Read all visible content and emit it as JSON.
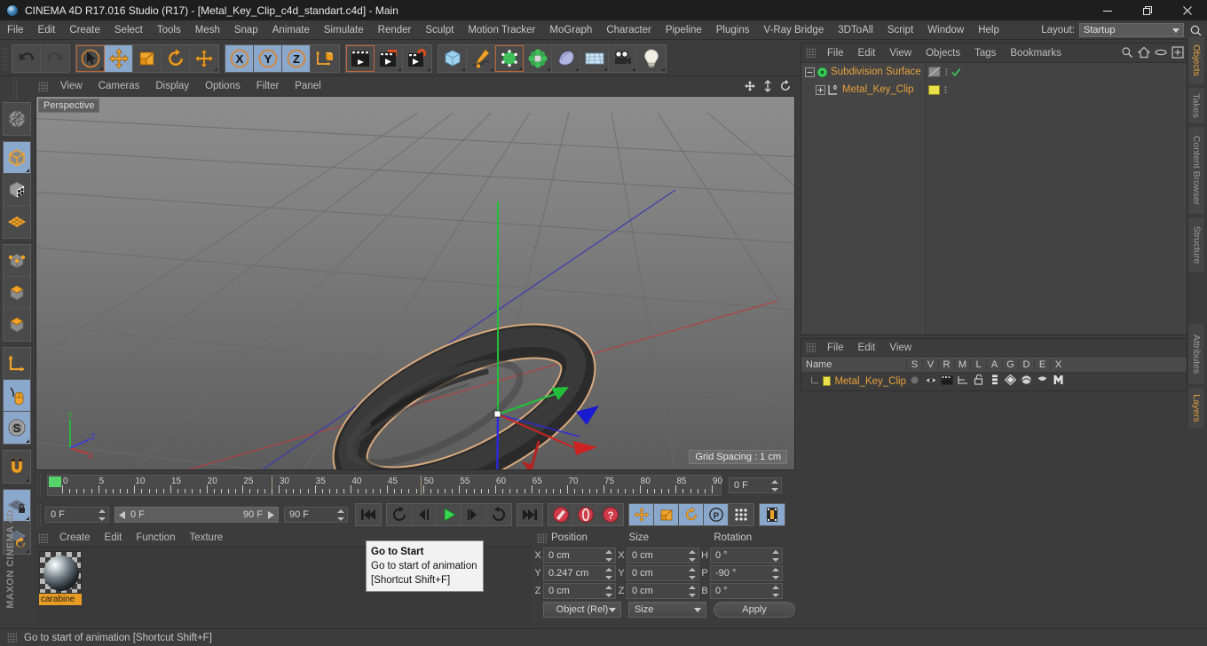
{
  "window": {
    "title": "CINEMA 4D R17.016 Studio (R17) - [Metal_Key_Clip_c4d_standart.c4d] - Main",
    "minimize": "—",
    "maximize": "❐",
    "close": "✕"
  },
  "menubar": {
    "items": [
      "File",
      "Edit",
      "Create",
      "Select",
      "Tools",
      "Mesh",
      "Snap",
      "Animate",
      "Simulate",
      "Render",
      "Sculpt",
      "Motion Tracker",
      "MoGraph",
      "Character",
      "Pipeline",
      "Plugins",
      "V-Ray Bridge",
      "3DToAll",
      "Script",
      "Window",
      "Help"
    ],
    "layout_label": "Layout:",
    "layout_value": "Startup",
    "search_icon": "search-icon"
  },
  "toolbar": {
    "groups": [
      {
        "name": "undo-redo",
        "buttons": [
          {
            "name": "undo-icon",
            "label": "Undo"
          },
          {
            "name": "redo-icon",
            "label": "Redo"
          }
        ]
      },
      {
        "name": "tools",
        "buttons": [
          {
            "name": "live-selection-icon",
            "label": "Live Selection"
          },
          {
            "name": "move-icon",
            "label": "Move"
          },
          {
            "name": "scale-icon",
            "label": "Scale"
          },
          {
            "name": "rotate-icon",
            "label": "Rotate"
          },
          {
            "name": "move-variant-icon",
            "label": "Move Tool Variant"
          }
        ]
      },
      {
        "name": "axis-locks",
        "buttons": [
          {
            "name": "axis-x-icon",
            "label": "X"
          },
          {
            "name": "axis-y-icon",
            "label": "Y"
          },
          {
            "name": "axis-z-icon",
            "label": "Z"
          },
          {
            "name": "world-object-coordinate-icon",
            "label": "World/Object"
          }
        ]
      },
      {
        "name": "render",
        "buttons": [
          {
            "name": "render-view-icon",
            "label": "Render View"
          },
          {
            "name": "render-region-icon",
            "label": "Render to Picture Viewer"
          },
          {
            "name": "render-settings-icon",
            "label": "Edit Render Settings"
          }
        ]
      },
      {
        "name": "objects",
        "buttons": [
          {
            "name": "cube-primitive-icon",
            "label": "Add Cube Object"
          },
          {
            "name": "spline-pen-icon",
            "label": "Add Spline"
          },
          {
            "name": "generator-icon",
            "label": "Add Generator / NURBS"
          },
          {
            "name": "array-icon",
            "label": "Add Modelling Object"
          },
          {
            "name": "deformer-icon",
            "label": "Add Bend Deformer"
          },
          {
            "name": "floor-environment-icon",
            "label": "Add Environment / Floor"
          },
          {
            "name": "camera-icon",
            "label": "Add Camera"
          },
          {
            "name": "light-icon",
            "label": "Add Light"
          }
        ]
      }
    ]
  },
  "leftbar": {
    "buttons": [
      {
        "name": "make-editable-icon",
        "label": "Make Editable"
      },
      {
        "name": "model-mode-icon",
        "label": "Model Mode",
        "active": true
      },
      {
        "name": "texture-mode-icon",
        "label": "Texture Mode"
      },
      {
        "name": "workplane-mode-icon",
        "label": "Workplane Mode"
      },
      {
        "name": "points-mode-icon",
        "label": "Points Mode"
      },
      {
        "name": "edges-mode-icon",
        "label": "Edges Mode"
      },
      {
        "name": "polygons-mode-icon",
        "label": "Polygons Mode"
      },
      {
        "name": "object-axis-icon",
        "label": "Enable Axis Modification"
      },
      {
        "name": "viewport-solo-icon",
        "label": "Viewport Solo",
        "active": true
      },
      {
        "name": "snap-enable-icon",
        "label": "Enable Snapping",
        "active": true
      },
      {
        "name": "magnet-icon",
        "label": "Magnet"
      },
      {
        "name": "workplane-lock-icon",
        "label": "Lock Workplane",
        "active": true
      },
      {
        "name": "workplane-rotate-icon",
        "label": "Planar Workplane Rotate"
      }
    ],
    "brand": "MAXON CINEMA 4D"
  },
  "viewport": {
    "menu": [
      "View",
      "Cameras",
      "Display",
      "Options",
      "Filter",
      "Panel"
    ],
    "view_label": "Perspective",
    "grid_spacing": "Grid Spacing : 1 cm",
    "axis_gizmo": {
      "x": "X",
      "y": "Y",
      "z": "Z"
    }
  },
  "timeline": {
    "ticks": [
      0,
      5,
      10,
      15,
      20,
      25,
      30,
      35,
      40,
      45,
      50,
      55,
      60,
      65,
      70,
      75,
      80,
      85,
      90
    ],
    "current_frame_field": "0 F",
    "start_field": "0 F",
    "scrub_start": "0 F",
    "scrub_end": "90 F",
    "end_field": "90 F",
    "frame_right_field": "0 F"
  },
  "playback": {
    "buttons": [
      {
        "name": "go-to-start-button",
        "label": "Go to Start"
      },
      {
        "name": "play-reverse-loop-button",
        "label": "Play Reverse"
      },
      {
        "name": "go-to-previous-frame-button",
        "label": "Go to Previous Frame"
      },
      {
        "name": "play-forward-button",
        "label": "Play Forward"
      },
      {
        "name": "go-to-next-frame-button",
        "label": "Go to Next Frame"
      },
      {
        "name": "play-loop-button",
        "label": "Loop Playback"
      },
      {
        "name": "go-to-end-button",
        "label": "Go to End"
      },
      {
        "name": "record-active-objects-button",
        "label": "Record Active Objects"
      },
      {
        "name": "autokeying-button",
        "label": "Autokeying"
      },
      {
        "name": "keyframe-selection-button",
        "label": "Keyframe Selection"
      },
      {
        "name": "key-position-button",
        "label": "Position"
      },
      {
        "name": "key-scale-button",
        "label": "Scale"
      },
      {
        "name": "key-rotation-button",
        "label": "Rotation"
      },
      {
        "name": "key-parameter-button",
        "label": "Parameter"
      },
      {
        "name": "key-pla-button",
        "label": "Point Level Animation"
      },
      {
        "name": "timeline-toggle-button",
        "label": "Timeline"
      }
    ]
  },
  "tooltip": {
    "title": "Go to Start",
    "description": "Go to start of animation",
    "shortcut": "[Shortcut Shift+F]"
  },
  "material_manager": {
    "menu": [
      "Create",
      "Edit",
      "Function",
      "Texture"
    ],
    "materials": [
      {
        "name": "carabiner",
        "display": "carabine"
      }
    ]
  },
  "coordinates": {
    "headers": [
      "Position",
      "Size",
      "Rotation"
    ],
    "rows": [
      {
        "plab": "X",
        "pval": "0 cm",
        "slab": "X",
        "sval": "0 cm",
        "rlab": "H",
        "rval": "0 °"
      },
      {
        "plab": "Y",
        "pval": "0.247 cm",
        "slab": "Y",
        "sval": "0 cm",
        "rlab": "P",
        "rval": "-90 °"
      },
      {
        "plab": "Z",
        "pval": "0 cm",
        "slab": "Z",
        "sval": "0 cm",
        "rlab": "B",
        "rval": "0 °"
      }
    ],
    "mode_dropdown": "Object (Rel)",
    "size_dropdown": "Size",
    "apply_button": "Apply"
  },
  "object_manager": {
    "menu": [
      "File",
      "Edit",
      "View",
      "Objects",
      "Tags",
      "Bookmarks"
    ],
    "header_icons": [
      "search-icon",
      "home-icon",
      "ellipse-icon",
      "add-icon"
    ],
    "tree": [
      {
        "name": "Subdivision Surface",
        "depth": 0,
        "icon": "subdivision-surface-icon",
        "tag_color": "none",
        "checked": true
      },
      {
        "name": "Metal_Key_Clip",
        "depth": 1,
        "icon": "polygon-object-icon",
        "tag_color": "#ece14a",
        "checked": false
      }
    ]
  },
  "attributes_panel": {
    "menu": [
      "File",
      "Edit",
      "View"
    ],
    "columns": [
      "Name",
      "S",
      "V",
      "R",
      "M",
      "L",
      "A",
      "G",
      "D",
      "E",
      "X"
    ],
    "rows": [
      {
        "name": "Metal_Key_Clip",
        "color": "#ece14a"
      }
    ]
  },
  "vertical_tabs": {
    "right_top": [
      {
        "label": "Objects",
        "active": true
      },
      {
        "label": "Takes",
        "active": false
      },
      {
        "label": "Content Browser",
        "active": false
      },
      {
        "label": "Structure",
        "active": false
      }
    ],
    "right_bottom": [
      {
        "label": "Attributes",
        "active": false
      },
      {
        "label": "Layers",
        "active": true
      }
    ]
  },
  "statusbar": {
    "message": "Go to start of animation [Shortcut Shift+F]"
  },
  "colors": {
    "accent_orange": "#e6a13c",
    "active_blue": "#8aa7cc",
    "panel_bg": "#3c3c3c",
    "field_bg": "#454545",
    "green_marker": "#56d36a"
  }
}
